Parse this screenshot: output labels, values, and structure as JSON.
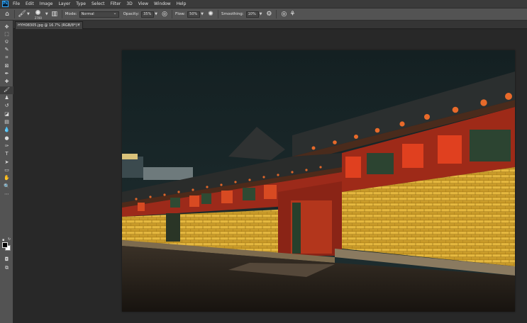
{
  "app": {
    "logo_text": "Ps"
  },
  "menu": [
    "File",
    "Edit",
    "Image",
    "Layer",
    "Type",
    "Select",
    "Filter",
    "3D",
    "View",
    "Window",
    "Help"
  ],
  "options": {
    "brush_size": "2700",
    "mode_label": "Mode:",
    "mode_value": "Normal",
    "opacity_label": "Opacity:",
    "opacity_value": "35%",
    "flow_label": "Flow:",
    "flow_value": "50%",
    "smoothing_label": "Smoothing:",
    "smoothing_value": "10%"
  },
  "document": {
    "tab_label": "HYH08305.jpg @ 16.7% (RGB/8*) *",
    "close_glyph": "×"
  },
  "tools": [
    {
      "name": "move-tool-icon",
      "glyph": "✥"
    },
    {
      "name": "marquee-tool-icon",
      "glyph": "⬚"
    },
    {
      "name": "lasso-tool-icon",
      "glyph": "ଡ"
    },
    {
      "name": "quick-select-tool-icon",
      "glyph": "✎"
    },
    {
      "name": "crop-tool-icon",
      "glyph": "⌗"
    },
    {
      "name": "frame-tool-icon",
      "glyph": "⊠"
    },
    {
      "name": "eyedropper-tool-icon",
      "glyph": "✒"
    },
    {
      "name": "healing-brush-tool-icon",
      "glyph": "✚"
    },
    {
      "name": "brush-tool-icon",
      "glyph": "🖌"
    },
    {
      "name": "clone-stamp-tool-icon",
      "glyph": "♟"
    },
    {
      "name": "history-brush-tool-icon",
      "glyph": "↺"
    },
    {
      "name": "eraser-tool-icon",
      "glyph": "◪"
    },
    {
      "name": "gradient-tool-icon",
      "glyph": "▤"
    },
    {
      "name": "blur-tool-icon",
      "glyph": "💧"
    },
    {
      "name": "dodge-tool-icon",
      "glyph": "●"
    },
    {
      "name": "pen-tool-icon",
      "glyph": "✑"
    },
    {
      "name": "type-tool-icon",
      "glyph": "T"
    },
    {
      "name": "path-select-tool-icon",
      "glyph": "➤"
    },
    {
      "name": "rectangle-tool-icon",
      "glyph": "▭"
    },
    {
      "name": "hand-tool-icon",
      "glyph": "✋"
    },
    {
      "name": "zoom-tool-icon",
      "glyph": "🔍"
    },
    {
      "name": "more-tools-icon",
      "glyph": "⋯"
    }
  ],
  "bottom_tools": [
    {
      "name": "quick-mask-icon",
      "glyph": "◘"
    },
    {
      "name": "screen-mode-icon",
      "glyph": "⧉"
    }
  ],
  "colors": {
    "menubar": "#3b3b3b",
    "optionsbar": "#535353",
    "workspace": "#282828",
    "foreground": "#000000",
    "background": "#ffffff",
    "accent": "#31a8ff"
  }
}
